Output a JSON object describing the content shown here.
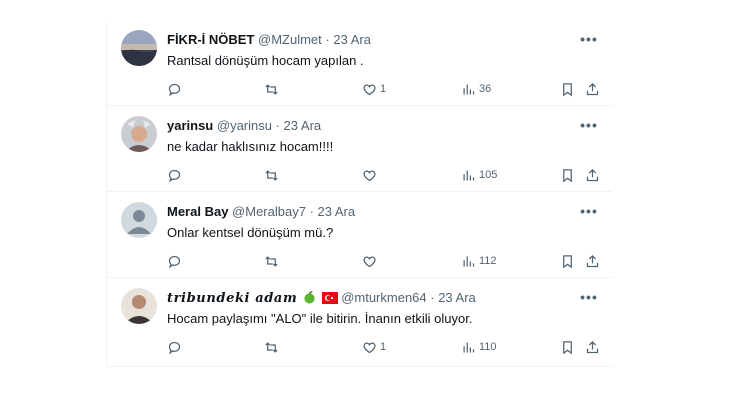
{
  "tweets": [
    {
      "name": "FİKR-İ NÖBET",
      "handle": "@MZulmet",
      "date": "23 Ara",
      "text": "Rantsal dönüşüm hocam yapılan .",
      "likes": "1",
      "views": "36",
      "avatar": "landscape-photo"
    },
    {
      "name": "yarinsu",
      "handle": "@yarinsu",
      "date": "23 Ara",
      "text": "ne kadar haklısınız hocam!!!!",
      "likes": "",
      "views": "105",
      "avatar": "person-photo"
    },
    {
      "name": "Meral Bay",
      "handle": "@Meralbay7",
      "date": "23 Ara",
      "text": "Onlar kentsel dönüşüm mü.?",
      "likes": "",
      "views": "112",
      "avatar": "default-avatar"
    },
    {
      "name": "tribundeki adam",
      "handle": "@mturkmen64",
      "date": "23 Ara",
      "text": "Hocam paylaşımı \"ALO\" ile bitirin. İnanın etkili oluyor.",
      "likes": "1",
      "views": "110",
      "avatar": "person-photo",
      "name_emoji": [
        "green-apple-icon",
        "turkey-flag-icon"
      ]
    }
  ],
  "separator": " · ",
  "more_label": "•••",
  "colors": {
    "text": "#0f1419",
    "secondary": "#536471",
    "border": "#eff3f4"
  }
}
